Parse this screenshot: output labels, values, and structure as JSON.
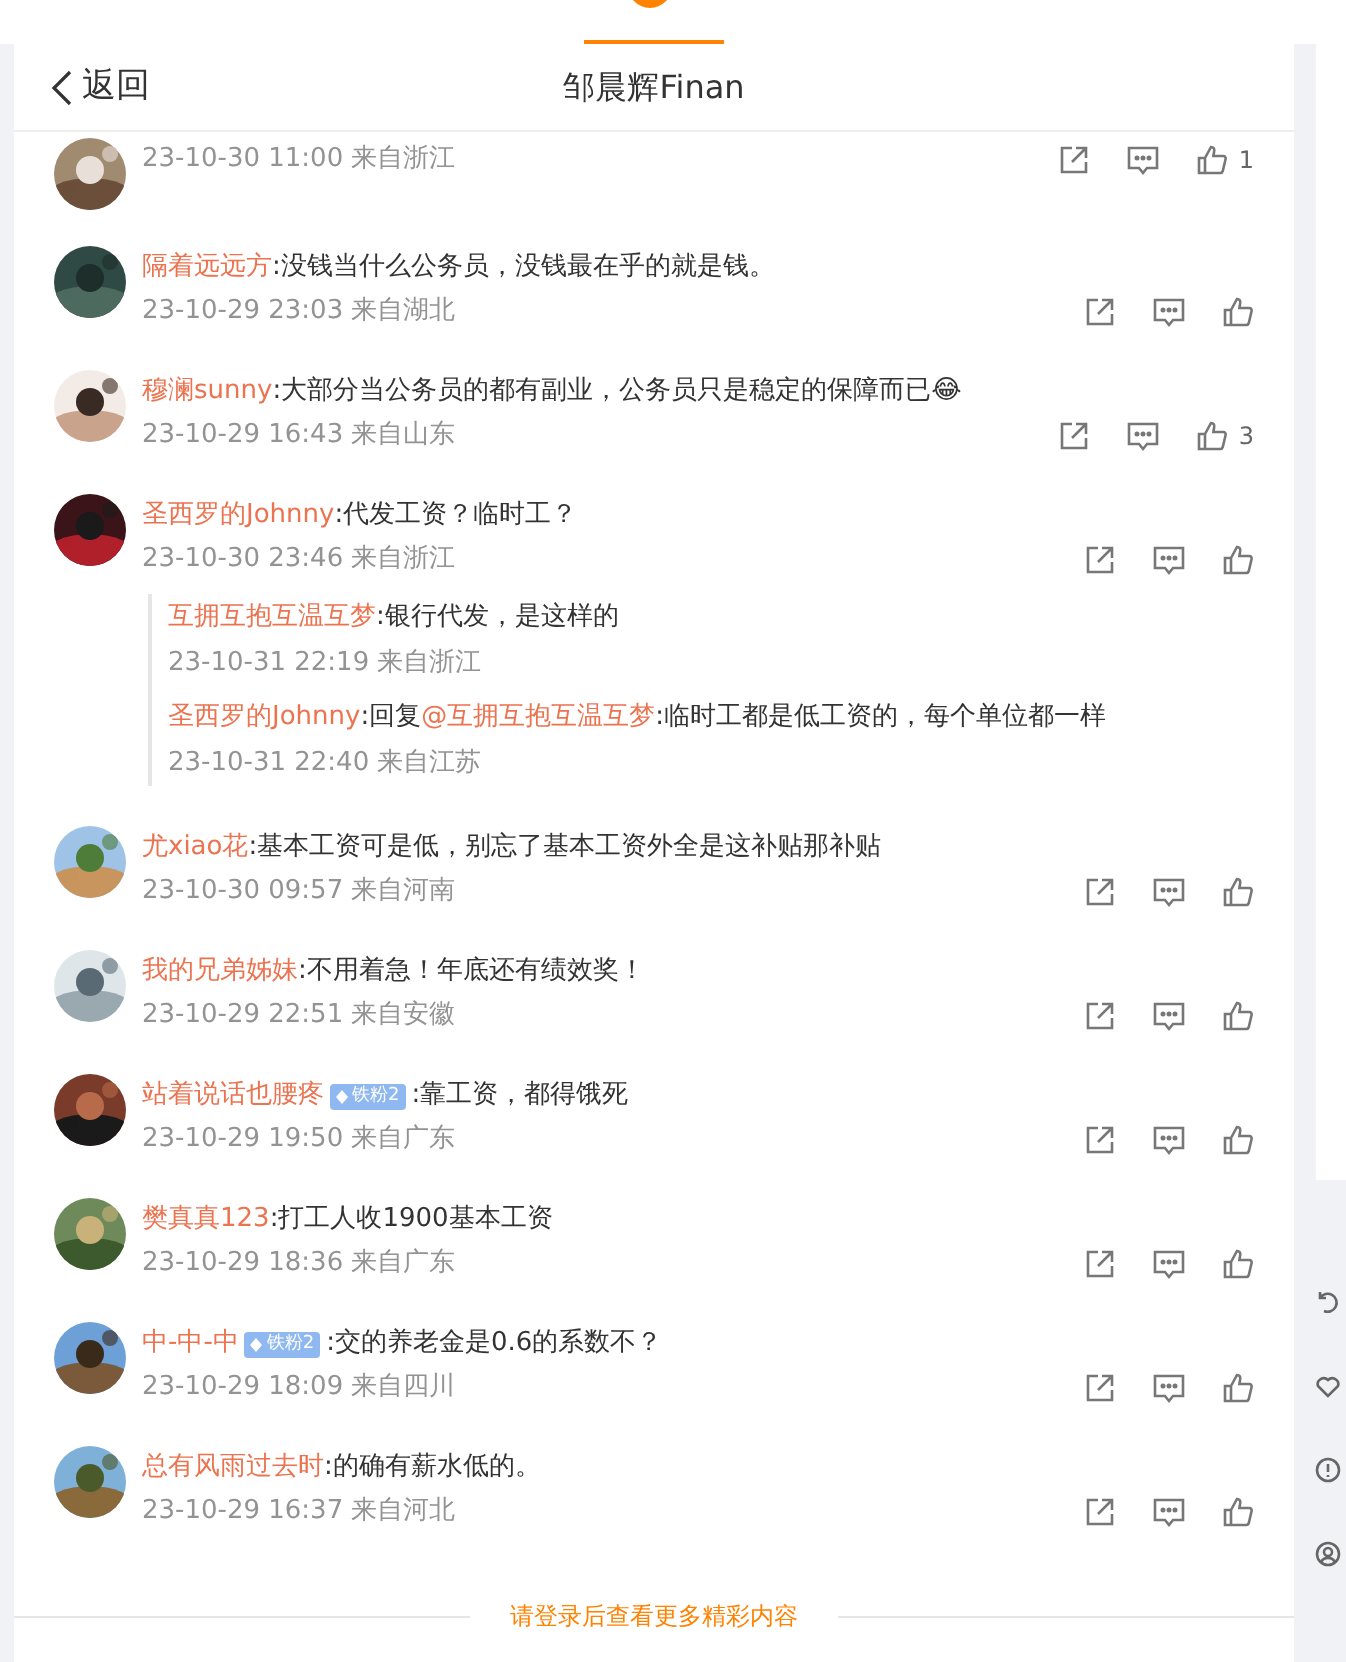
{
  "header": {
    "back": "返回",
    "title": "邹晨辉Finan"
  },
  "comments": [
    {
      "meta": "23-10-30 11:00 来自浙江",
      "likes": "1"
    },
    {
      "name": "隔着远远方",
      "text": ":没钱当什么公务员，没钱最在乎的就是钱。",
      "meta": "23-10-29 23:03 来自湖北"
    },
    {
      "name": "穆澜sunny",
      "text": ":大部分当公务员的都有副业，公务员只是稳定的保障而已😂",
      "meta": "23-10-29 16:43 来自山东",
      "likes": "3"
    },
    {
      "name": "圣西罗的Johnny",
      "text": ":代发工资？临时工？",
      "meta": "23-10-30 23:46 来自浙江",
      "replies": [
        {
          "name": "互拥互抱互温互梦",
          "text": ":银行代发，是这样的",
          "meta": "23-10-31 22:19 来自浙江"
        },
        {
          "name": "圣西罗的Johnny",
          "reply_prefix": ":回复",
          "mention": "@互拥互抱互温互梦",
          "text": ":临时工都是低工资的，每个单位都一样",
          "meta": "23-10-31 22:40 来自江苏"
        }
      ]
    },
    {
      "name": "尤xiao花",
      "text": ":基本工资可是低，别忘了基本工资外全是这补贴那补贴",
      "meta": "23-10-30 09:57 来自河南"
    },
    {
      "name": "我的兄弟姊妹",
      "text": ":不用着急！年底还有绩效奖！",
      "meta": "23-10-29 22:51 来自安徽"
    },
    {
      "name": "站着说话也腰疼",
      "text": ":靠工资，都得饿死",
      "meta": "23-10-29 19:50 来自广东",
      "badge": "铁粉2"
    },
    {
      "name": "樊真真123",
      "text": ":打工人收1900基本工资",
      "meta": "23-10-29 18:36 来自广东"
    },
    {
      "name": "中-中-中",
      "text": ":交的养老金是0.6的系数不？",
      "meta": "23-10-29 18:09 来自四川",
      "badge": "铁粉2"
    },
    {
      "name": "总有风雨过去时",
      "text": ":的确有薪水低的。",
      "meta": "23-10-29 16:37 来自河北"
    }
  ],
  "footer": "请登录后查看更多精彩内容"
}
